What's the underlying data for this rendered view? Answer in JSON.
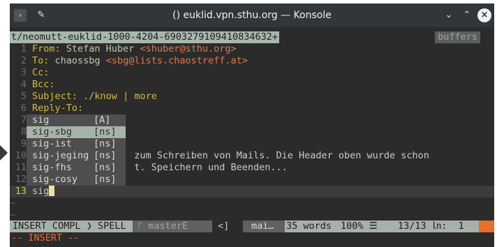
{
  "window": {
    "title": "() euklid.vpn.sthu.org — Konsole",
    "menu_icon": "chevron-right-icon",
    "pin_icon": "pin-icon",
    "min_icon": "chevron-down-icon",
    "max_icon": "chevron-up-icon",
    "close_icon": "close-icon"
  },
  "tabline": {
    "active_tab": "t/neomutt-euklid-1000-4204-6903279109410834632+",
    "buffers_label": "buffers"
  },
  "lines": [
    {
      "n": "1",
      "key": "From:",
      "val": "Stefan Huber",
      "mail": "<shuber@sthu.org>"
    },
    {
      "n": "2",
      "key": "To:",
      "val": "chaossbg",
      "mail": "<sbg@lists.chaostreff.at>"
    },
    {
      "n": "3",
      "key": "Cc:",
      "val": "",
      "mail": ""
    },
    {
      "n": "4",
      "key": "Bcc:",
      "val": "",
      "mail": ""
    },
    {
      "n": "5",
      "key": "Subject:",
      "val": "./know | more",
      "mail": ""
    },
    {
      "n": "6",
      "key": "Reply-To:",
      "val": "",
      "mail": ""
    },
    {
      "n": "7",
      "text": ""
    },
    {
      "n": "8",
      "text": ""
    },
    {
      "n": "9",
      "text": ""
    },
    {
      "n": "10",
      "text": "                  zum Schreiben von Mails. Die Header oben wurde schon"
    },
    {
      "n": "11",
      "text": "                  t. Speichern und Beenden..."
    },
    {
      "n": "12",
      "text": ""
    },
    {
      "n": "13",
      "text": "sig"
    }
  ],
  "tildes": [
    "~",
    "~"
  ],
  "completion_menu": [
    {
      "word": "sig",
      "kind": "[A]",
      "selected": false
    },
    {
      "word": "sig-sbg",
      "kind": "[ns]",
      "selected": true
    },
    {
      "word": "sig-ist",
      "kind": "[ns]",
      "selected": false
    },
    {
      "word": "sig-jeging",
      "kind": "[ns]",
      "selected": false
    },
    {
      "word": "sig-fhs",
      "kind": "[ns]",
      "selected": false
    },
    {
      "word": "sig-cosy",
      "kind": "[ns]",
      "selected": false
    }
  ],
  "statusline": {
    "mode": "INSERT COMPL",
    "spell": "SPELL",
    "git": "ᚠ masterE",
    "arrow": "<]",
    "file": "mai…",
    "words": "35 words",
    "percent": "100% ☰",
    "position": "13/13 ㏑:  1",
    "warn_color": "#e86e2a"
  },
  "cmdline": "-- INSERT --",
  "colors": {
    "accent": "#d7b940",
    "mail": "#e0784b",
    "status_bg": "#a7b0a9"
  }
}
